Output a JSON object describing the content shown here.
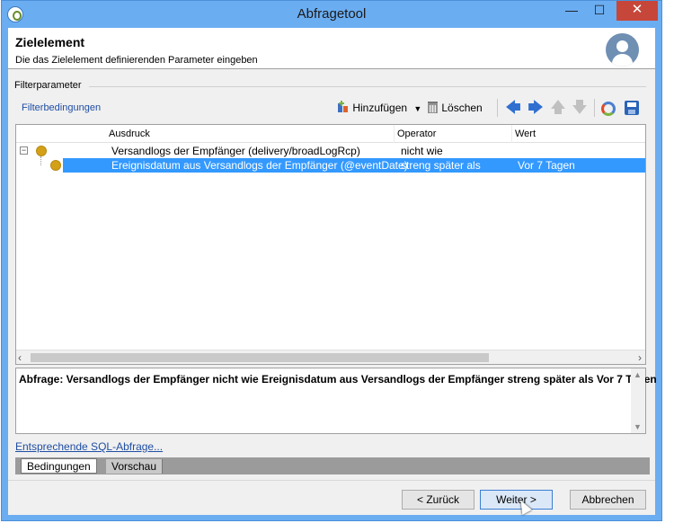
{
  "window": {
    "title": "Abfragetool",
    "minimize": "—",
    "maximize": "☐",
    "close": "✕"
  },
  "header": {
    "title": "Zielelement",
    "subtitle": "Die das Zielelement definierenden Parameter eingeben"
  },
  "filter": {
    "group_label": "Filterparameter",
    "toolbar_title": "Filterbedingungen",
    "add_label": "Hinzufügen",
    "delete_label": "Löschen"
  },
  "grid": {
    "columns": [
      "Ausdruck",
      "Operator",
      "Wert"
    ],
    "rows": [
      {
        "expression": "Versandlogs der Empfänger (delivery/broadLogRcp)",
        "operator": "nicht wie",
        "value": ""
      },
      {
        "expression": "Ereignisdatum aus Versandlogs der Empfänger (@eventDate)",
        "operator": "streng später als",
        "value": "Vor 7 Tagen"
      }
    ]
  },
  "query": {
    "text": "Abfrage: Versandlogs der Empfänger nicht wie Ereignisdatum aus Versandlogs der Empfänger streng später als Vor 7 Tagen"
  },
  "sql_link": "Entsprechende SQL-Abfrage...",
  "tabs": [
    "Bedingungen",
    "Vorschau"
  ],
  "footer": {
    "back_label": "< Zurück",
    "next_label": "Weiter >",
    "cancel_label": "Abbrechen"
  },
  "icons": {
    "add": "add-condition-icon",
    "delete": "trash-icon",
    "refresh": "refresh-icon",
    "save": "save-icon"
  },
  "colors": {
    "selection": "#3399ff",
    "link": "#1f4ea3",
    "title_bar": "#6badf1"
  }
}
